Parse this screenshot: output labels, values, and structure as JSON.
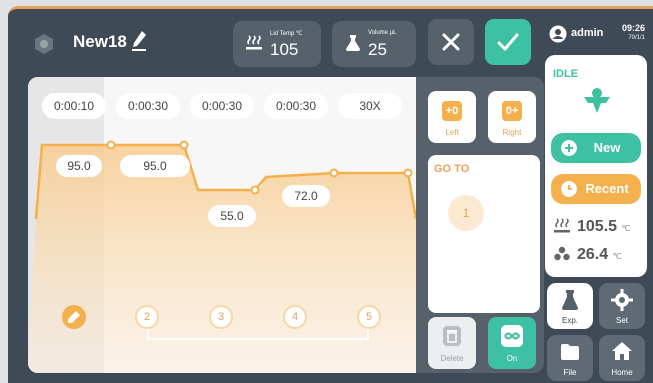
{
  "header": {
    "program_name": "New18",
    "lid_temp_label": "Lid Temp ℃",
    "lid_temp_value": "105",
    "volume_label": "Volume µL",
    "volume_value": "25"
  },
  "graph": {
    "times": [
      "0:00:10",
      "0:00:30",
      "0:00:30",
      "0:00:30",
      "30X"
    ],
    "temps": [
      "95.0",
      "95.0",
      "55.0",
      "72.0"
    ],
    "steps": [
      "2",
      "3",
      "4",
      "5"
    ]
  },
  "controls": {
    "left_glyph": "+0",
    "left_label": "Left",
    "right_glyph": "0+",
    "right_label": "Right",
    "goto_title": "GO TO",
    "goto_value": "1",
    "delete_label": "Delete",
    "on_label": "On"
  },
  "sidebar": {
    "user": "admin",
    "time": "09:26",
    "date": "70/1/1",
    "status": "IDLE",
    "new_label": "New",
    "recent_label": "Recent",
    "lid_temp": "105.5",
    "block_temp": "26.4",
    "temp_unit": "℃",
    "exp_label": "Exp.",
    "set_label": "Set",
    "file_label": "File",
    "home_label": "Home"
  },
  "colors": {
    "accent_orange": "#f5b04e",
    "accent_green": "#3ec1a3",
    "panel_dark": "#3e4a56"
  }
}
